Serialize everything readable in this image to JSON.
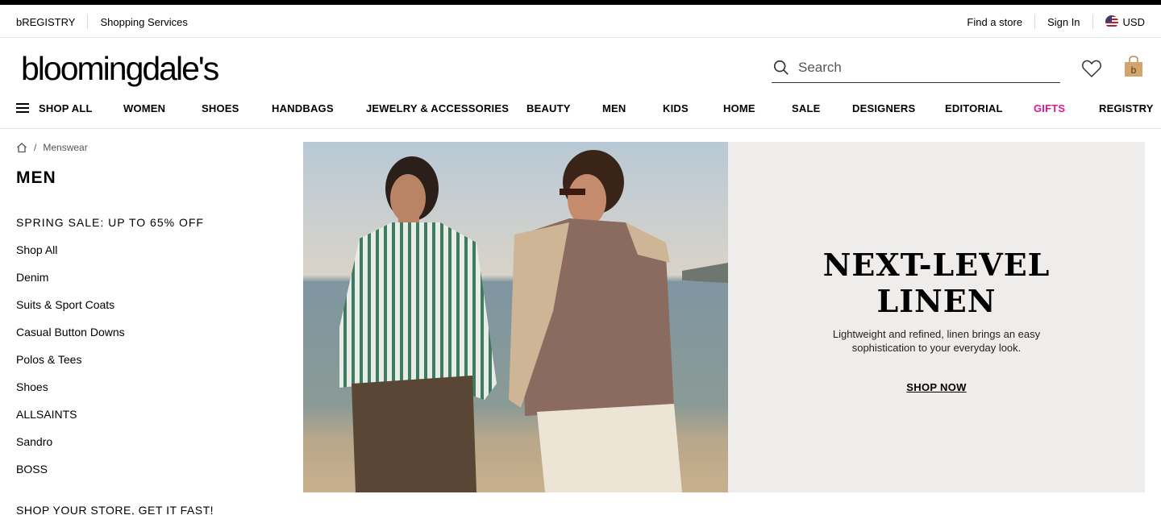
{
  "utility": {
    "registry": "bREGISTRY",
    "shopping_services": "Shopping Services",
    "find_store": "Find a store",
    "sign_in": "Sign In",
    "currency": "USD"
  },
  "logo": {
    "text": "bloomingdale's"
  },
  "search": {
    "placeholder": "Search"
  },
  "nav": {
    "shop_all": "SHOP ALL",
    "items": [
      "WOMEN",
      "SHOES",
      "HANDBAGS",
      "JEWELRY & ACCESSORIES",
      "BEAUTY",
      "MEN",
      "KIDS",
      "HOME",
      "SALE",
      "DESIGNERS",
      "EDITORIAL",
      "GIFTS",
      "REGISTRY"
    ]
  },
  "breadcrumb": {
    "current": "Menswear"
  },
  "page_title": "MEN",
  "sidebar": {
    "heading": "SPRING SALE: UP TO 65% OFF",
    "items": [
      "Shop All",
      "Denim",
      "Suits & Sport Coats",
      "Casual Button Downs",
      "Polos & Tees",
      "Shoes",
      "ALLSAINTS",
      "Sandro",
      "BOSS"
    ],
    "heading2": "SHOP YOUR STORE, GET IT FAST!"
  },
  "hero": {
    "headline_line1": "NEXT-LEVEL",
    "headline_line2": "LINEN",
    "subtext": "Lightweight and refined, linen brings an easy sophistication to your everyday look.",
    "cta": "SHOP NOW"
  },
  "colors": {
    "gifts_accent": "#e0198f",
    "panel_bg": "#efedeb",
    "topbar": "#000000"
  },
  "icons": [
    "home-icon",
    "search-icon",
    "heart-icon",
    "shopping-bag-icon",
    "us-flag-icon",
    "hamburger-icon"
  ]
}
